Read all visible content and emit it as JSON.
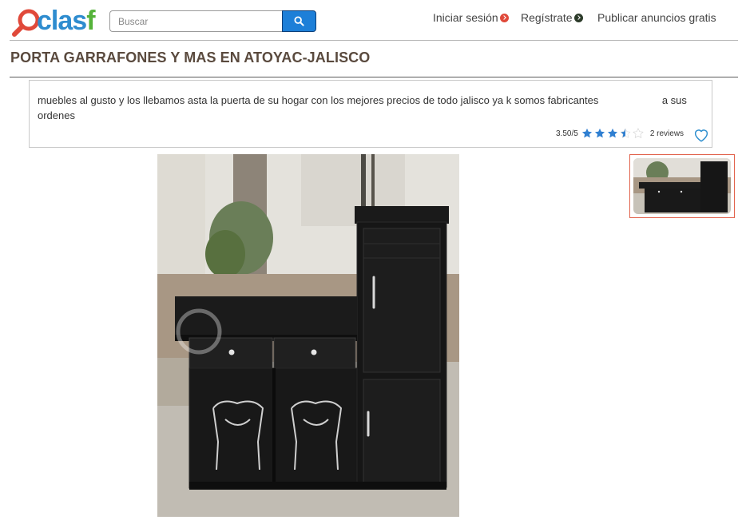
{
  "header": {
    "logo_text_part1": "clas",
    "logo_text_part2": "f",
    "search": {
      "placeholder": "Buscar",
      "value": ""
    },
    "nav": {
      "login_label": "Iniciar sesión",
      "register_label": "Regístrate",
      "publish_label": "Publicar anuncios gratis"
    }
  },
  "listing": {
    "title": "PORTA GARRAFONES Y MAS EN ATOYAC-JALISCO",
    "description": "muebles al gusto y los llebamos asta la puerta de su hogar con los mejores precios de todo jalisco ya k somos fabricantes                      a sus ordenes",
    "rating_value": "3.50/5",
    "rating_fraction": 0.7,
    "stars": [
      "full",
      "full",
      "full",
      "half",
      "empty"
    ],
    "reviews_label": "2 reviews"
  },
  "colors": {
    "accent_blue": "#1d7fd8",
    "logo_blue": "#2e8ccf",
    "logo_green": "#55b33a",
    "login_dot": "#e0493a",
    "register_dot": "#2c3b2a",
    "title": "#5a4a3e",
    "star": "#2f7fd1",
    "thumb_border": "#e2634d"
  },
  "icons": {
    "search_button": "search-icon",
    "favorite": "heart-icon",
    "logo": "magnifier-logo-icon"
  }
}
